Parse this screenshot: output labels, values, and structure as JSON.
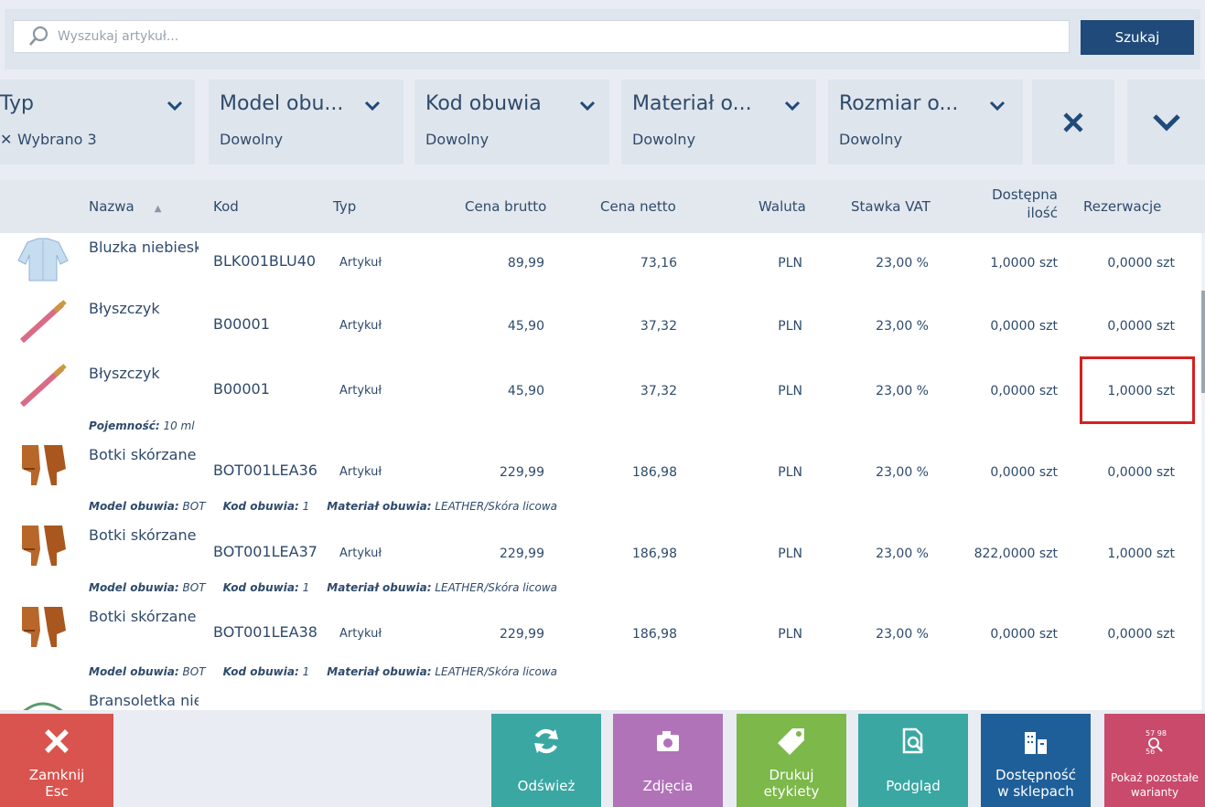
{
  "search": {
    "placeholder": "Wyszukaj artykuł...",
    "button_label": "Szukaj"
  },
  "filters": [
    {
      "title": "Typ",
      "value": "Wybrano 3"
    },
    {
      "title": "Model obu...",
      "value": "Dowolny"
    },
    {
      "title": "Kod obuwia",
      "value": "Dowolny"
    },
    {
      "title": "Materiał o...",
      "value": "Dowolny"
    },
    {
      "title": "Rozmiar o...",
      "value": "Dowolny"
    }
  ],
  "table": {
    "columns": [
      "Nazwa",
      "Kod",
      "Typ",
      "Cena brutto",
      "Cena netto",
      "Waluta",
      "Stawka VAT",
      "Dostępna ilość",
      "Rezerwacje"
    ],
    "sort_indicator": "▲",
    "rows": [
      {
        "name": "Bluzka niebieska",
        "code": "BLK001BLU40",
        "type": "Artykuł",
        "gross": "89,99",
        "net": "73,16",
        "currency": "PLN",
        "vat": "23,00 %",
        "available": "1,0000 szt",
        "reserved": "0,0000 szt"
      },
      {
        "name": "Błyszczyk",
        "code": "B00001",
        "type": "Artykuł",
        "gross": "45,90",
        "net": "37,32",
        "currency": "PLN",
        "vat": "23,00 %",
        "available": "0,0000 szt",
        "reserved": "0,0000 szt"
      },
      {
        "name": "Błyszczyk",
        "code": "B00001",
        "type": "Artykuł",
        "gross": "45,90",
        "net": "37,32",
        "currency": "PLN",
        "vat": "23,00 %",
        "available": "0,0000 szt",
        "reserved": "1,0000 szt",
        "attr_label": "Pojemność:",
        "attr_value": "10 ml"
      },
      {
        "name": "Botki skórzane",
        "code": "BOT001LEA36",
        "type": "Artykuł",
        "gross": "229,99",
        "net": "186,98",
        "currency": "PLN",
        "vat": "23,00 %",
        "available": "0,0000 szt",
        "reserved": "0,0000 szt"
      },
      {
        "name": "Botki skórzane",
        "code": "BOT001LEA37",
        "type": "Artykuł",
        "gross": "229,99",
        "net": "186,98",
        "currency": "PLN",
        "vat": "23,00 %",
        "available": "822,0000 szt",
        "reserved": "1,0000 szt"
      },
      {
        "name": "Botki skórzane",
        "code": "BOT001LEA38",
        "type": "Artykuł",
        "gross": "229,99",
        "net": "186,98",
        "currency": "PLN",
        "vat": "23,00 %",
        "available": "0,0000 szt",
        "reserved": "0,0000 szt"
      },
      {
        "name": "Bransoletka nie"
      }
    ],
    "boot_attrs": {
      "model_label": "Model obuwia:",
      "model_value": "BOT",
      "kod_label": "Kod obuwia:",
      "kod_value": "1",
      "material_label": "Materiał obuwia:",
      "material_value": "LEATHER/Skóra licowa"
    }
  },
  "actions": {
    "close": {
      "line1": "Zamknij",
      "line2": "Esc",
      "color": "#d9534f"
    },
    "refresh": {
      "label": "Odśwież",
      "color": "#3aa7a3"
    },
    "photos": {
      "label": "Zdjęcia",
      "color": "#b073b8"
    },
    "print": {
      "line1": "Drukuj",
      "line2": "etykiety",
      "color": "#7cb84a"
    },
    "preview": {
      "label": "Podgląd",
      "color": "#3aa7a3"
    },
    "availability": {
      "line1": "Dostępność",
      "line2": "w sklepach",
      "color": "#1f5f99"
    },
    "variants": {
      "line1": "Pokaż pozostałe",
      "line2": "warianty",
      "color": "#c94a6b"
    }
  }
}
